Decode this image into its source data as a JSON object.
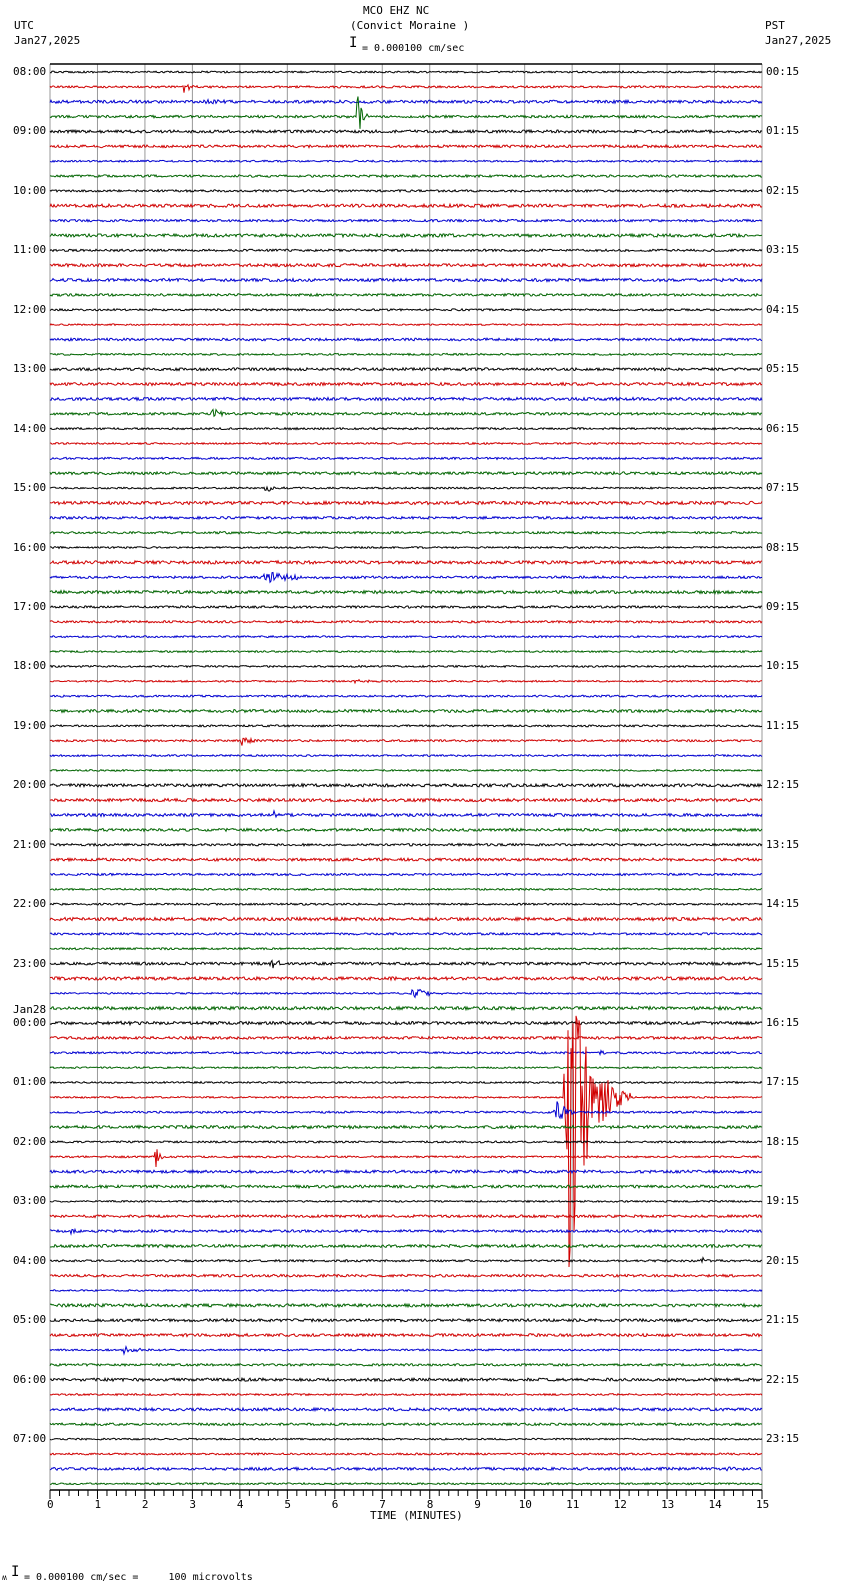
{
  "header": {
    "station": "MCO EHZ NC",
    "site": "(Convict Moraine )",
    "scale": "= 0.000100 cm/sec",
    "left_tz": "UTC",
    "left_date": "Jan27,2025",
    "right_tz": "PST",
    "right_date": "Jan27,2025"
  },
  "footer": {
    "scale_note": "= 0.000100 cm/sec =     100 microvolts",
    "mark": "ʍ"
  },
  "chart_data": {
    "type": "line",
    "title": "MCO EHZ NC (Convict Moraine ) helicorder",
    "xlabel": "TIME (MINUTES)",
    "xlim": [
      0,
      15
    ],
    "x_ticks": [
      "0",
      "1",
      "2",
      "3",
      "4",
      "5",
      "6",
      "7",
      "8",
      "9",
      "10",
      "11",
      "12",
      "13",
      "14",
      "15"
    ],
    "rows_per_hour": 4,
    "row_count": 96,
    "trace_colors": [
      "#000000",
      "#d00000",
      "#0000d0",
      "#006400"
    ],
    "left_labels": [
      "08:00",
      "09:00",
      "10:00",
      "11:00",
      "12:00",
      "13:00",
      "14:00",
      "15:00",
      "16:00",
      "17:00",
      "18:00",
      "19:00",
      "20:00",
      "21:00",
      "22:00",
      "23:00",
      "00:00",
      "01:00",
      "02:00",
      "03:00",
      "04:00",
      "05:00",
      "06:00",
      "07:00"
    ],
    "date_change_label": "Jan28",
    "right_labels": [
      "00:15",
      "01:15",
      "02:15",
      "03:15",
      "04:15",
      "05:15",
      "06:15",
      "07:15",
      "08:15",
      "09:15",
      "10:15",
      "11:15",
      "12:15",
      "13:15",
      "14:15",
      "15:15",
      "16:15",
      "17:15",
      "18:15",
      "19:15",
      "20:15",
      "21:15",
      "22:15",
      "23:15"
    ],
    "events": [
      {
        "row": 1,
        "minute": 2.8,
        "duration": 0.4,
        "amplitude": 10
      },
      {
        "row": 3,
        "minute": 6.45,
        "duration": 0.3,
        "amplitude": 42
      },
      {
        "row": 2,
        "minute": 3.2,
        "duration": 0.8,
        "amplitude": 3
      },
      {
        "row": 23,
        "minute": 3.4,
        "duration": 0.6,
        "amplitude": 7
      },
      {
        "row": 28,
        "minute": 4.5,
        "duration": 0.8,
        "amplitude": 4
      },
      {
        "row": 34,
        "minute": 4.4,
        "duration": 3.4,
        "amplitude": 6
      },
      {
        "row": 41,
        "minute": 6.4,
        "duration": 0.8,
        "amplitude": 4
      },
      {
        "row": 45,
        "minute": 4.0,
        "duration": 0.8,
        "amplitude": 7
      },
      {
        "row": 50,
        "minute": 4.7,
        "duration": 0.4,
        "amplitude": 5
      },
      {
        "row": 60,
        "minute": 4.6,
        "duration": 0.6,
        "amplitude": 7
      },
      {
        "row": 62,
        "minute": 7.6,
        "duration": 0.9,
        "amplitude": 9
      },
      {
        "row": 64,
        "minute": 1.3,
        "duration": 0.8,
        "amplitude": 5
      },
      {
        "row": 69,
        "minute": 10.82,
        "duration": 1.4,
        "amplitude": 260
      },
      {
        "row": 70,
        "minute": 10.6,
        "duration": 0.6,
        "amplitude": 22
      },
      {
        "row": 66,
        "minute": 11.5,
        "duration": 0.6,
        "amplitude": 5
      },
      {
        "row": 73,
        "minute": 2.2,
        "duration": 0.3,
        "amplitude": 18
      },
      {
        "row": 78,
        "minute": 0.4,
        "duration": 0.6,
        "amplitude": 5
      },
      {
        "row": 80,
        "minute": 13.7,
        "duration": 0.2,
        "amplitude": 10
      },
      {
        "row": 86,
        "minute": 1.5,
        "duration": 1.0,
        "amplitude": 5
      },
      {
        "row": 94,
        "minute": 14.2,
        "duration": 0.6,
        "amplitude": 4
      }
    ]
  }
}
